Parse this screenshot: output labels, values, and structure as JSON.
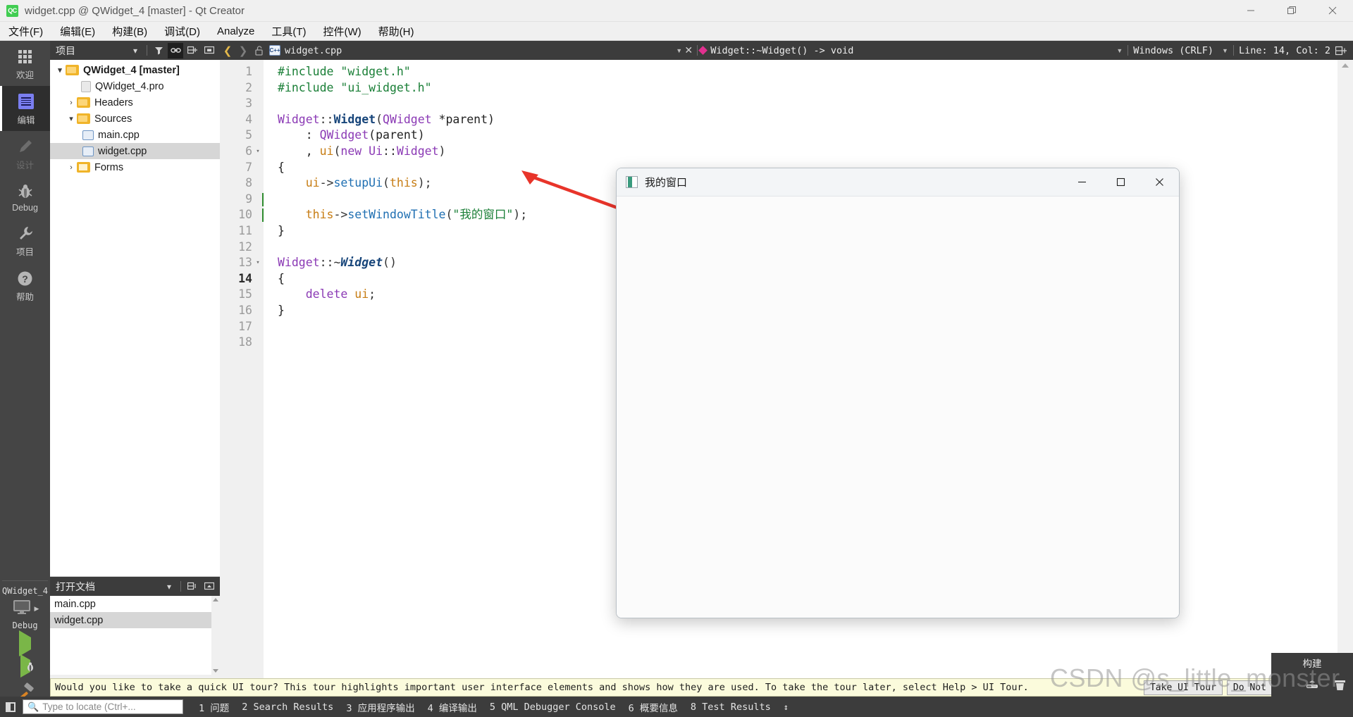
{
  "window": {
    "title": "widget.cpp @ QWidget_4 [master] - Qt Creator",
    "logo_text": "QC",
    "controls": {
      "minimize": "—",
      "maximize": "❐",
      "close": "✕"
    }
  },
  "menubar": {
    "items": [
      {
        "label": "文件(F)",
        "mnemonic": "F"
      },
      {
        "label": "编辑(E)",
        "mnemonic": "E"
      },
      {
        "label": "构建(B)",
        "mnemonic": "B"
      },
      {
        "label": "调试(D)",
        "mnemonic": "D"
      },
      {
        "label": "Analyze",
        "mnemonic": "A"
      },
      {
        "label": "工具(T)",
        "mnemonic": "T"
      },
      {
        "label": "控件(W)",
        "mnemonic": "W"
      },
      {
        "label": "帮助(H)",
        "mnemonic": "H"
      }
    ]
  },
  "modebar": {
    "items": [
      {
        "label": "欢迎",
        "icon": "grid-icon",
        "state": "normal"
      },
      {
        "label": "编辑",
        "icon": "document-lines-icon",
        "state": "active"
      },
      {
        "label": "设计",
        "icon": "pencil-icon",
        "state": "disabled"
      },
      {
        "label": "Debug",
        "icon": "bug-icon",
        "state": "normal"
      },
      {
        "label": "项目",
        "icon": "wrench-icon",
        "state": "normal"
      },
      {
        "label": "帮助",
        "icon": "question-circle-icon",
        "state": "normal"
      }
    ],
    "kit": {
      "project_name": "QWidget_4",
      "build_config": "Debug",
      "target_icon": "desktop-icon",
      "run_label": "run-button",
      "debug_label": "debug-button",
      "build_label": "build-hammer-button"
    }
  },
  "sidepanel": {
    "projects": {
      "header": "项目",
      "tools": [
        "chevron-down-icon",
        "filter-icon",
        "link-icon",
        "split-icon",
        "close-panel-icon"
      ],
      "tree": [
        {
          "label": "QWidget_4 [master]",
          "indent": 0,
          "arrow": "⌄",
          "icon": "folder",
          "bold": true,
          "selected": false
        },
        {
          "label": "QWidget_4.pro",
          "indent": 1,
          "arrow": "",
          "icon": "doc",
          "bold": false,
          "selected": false
        },
        {
          "label": "Headers",
          "indent": 1,
          "arrow": "›",
          "icon": "folder",
          "bold": false,
          "selected": false
        },
        {
          "label": "Sources",
          "indent": 1,
          "arrow": "⌄",
          "icon": "folder",
          "bold": false,
          "selected": false
        },
        {
          "label": "main.cpp",
          "indent": 2,
          "arrow": "",
          "icon": "cpp",
          "bold": false,
          "selected": false
        },
        {
          "label": "widget.cpp",
          "indent": 2,
          "arrow": "",
          "icon": "cpp",
          "bold": false,
          "selected": true
        },
        {
          "label": "Forms",
          "indent": 1,
          "arrow": "›",
          "icon": "form",
          "bold": false,
          "selected": false
        }
      ]
    },
    "opendocs": {
      "header": "打开文档",
      "tools": [
        "chevron-down-icon",
        "split-icon",
        "close-panel-icon"
      ],
      "items": [
        {
          "label": "main.cpp",
          "selected": false
        },
        {
          "label": "widget.cpp",
          "selected": true
        }
      ]
    }
  },
  "editor_toolbar": {
    "file_name": "widget.cpp",
    "symbol": "Widget::~Widget() -> void",
    "line_ending": "Windows (CRLF)",
    "cursor_pos": "Line: 14, Col: 2",
    "back_icon": "back-chevron-icon",
    "forward_icon": "forward-chevron-icon",
    "lock_icon": "unlocked-icon",
    "close_icon": "close-icon",
    "split_icon": "split-editor-icon"
  },
  "code": {
    "current_line": 14,
    "lines": [
      {
        "n": 1,
        "fold": "",
        "tokens": [
          {
            "t": "#include ",
            "c": "k-pre"
          },
          {
            "t": "\"widget.h\"",
            "c": "k-str"
          }
        ]
      },
      {
        "n": 2,
        "fold": "",
        "tokens": [
          {
            "t": "#include ",
            "c": "k-pre"
          },
          {
            "t": "\"ui_widget.h\"",
            "c": "k-str"
          }
        ]
      },
      {
        "n": 3,
        "fold": "",
        "tokens": []
      },
      {
        "n": 4,
        "fold": "",
        "tokens": [
          {
            "t": "Widget",
            "c": "k-kw"
          },
          {
            "t": "::",
            "c": "k-op"
          },
          {
            "t": "Widget",
            "c": "k-bold"
          },
          {
            "t": "(",
            "c": "k-op"
          },
          {
            "t": "QWidget",
            "c": "k-kw"
          },
          {
            "t": " *parent)",
            "c": "k-pln"
          }
        ]
      },
      {
        "n": 5,
        "fold": "",
        "tokens": [
          {
            "t": "    : ",
            "c": "k-pln"
          },
          {
            "t": "QWidget",
            "c": "k-kw"
          },
          {
            "t": "(parent)",
            "c": "k-pln"
          }
        ]
      },
      {
        "n": 6,
        "fold": "▾",
        "tokens": [
          {
            "t": "    , ",
            "c": "k-pln"
          },
          {
            "t": "ui",
            "c": "k-var"
          },
          {
            "t": "(",
            "c": "k-op"
          },
          {
            "t": "new",
            "c": "k-kw"
          },
          {
            "t": " ",
            "c": "k-pln"
          },
          {
            "t": "Ui",
            "c": "k-kw"
          },
          {
            "t": "::",
            "c": "k-op"
          },
          {
            "t": "Widget",
            "c": "k-kw"
          },
          {
            "t": ")",
            "c": "k-op"
          }
        ]
      },
      {
        "n": 7,
        "fold": "",
        "tokens": [
          {
            "t": "{",
            "c": "k-pln"
          }
        ]
      },
      {
        "n": 8,
        "fold": "",
        "tokens": [
          {
            "t": "    ",
            "c": "k-pln"
          },
          {
            "t": "ui",
            "c": "k-var"
          },
          {
            "t": "->",
            "c": "k-op"
          },
          {
            "t": "setupUi",
            "c": "k-fn"
          },
          {
            "t": "(",
            "c": "k-op"
          },
          {
            "t": "this",
            "c": "k-var"
          },
          {
            "t": ");",
            "c": "k-op"
          }
        ]
      },
      {
        "n": 9,
        "fold": "",
        "tokens": []
      },
      {
        "n": 10,
        "fold": "",
        "tokens": [
          {
            "t": "    ",
            "c": "k-pln"
          },
          {
            "t": "this",
            "c": "k-var"
          },
          {
            "t": "->",
            "c": "k-op"
          },
          {
            "t": "setWindowTitle",
            "c": "k-fn"
          },
          {
            "t": "(",
            "c": "k-op"
          },
          {
            "t": "\"我的窗口\"",
            "c": "k-str"
          },
          {
            "t": ");",
            "c": "k-op"
          }
        ]
      },
      {
        "n": 11,
        "fold": "",
        "tokens": [
          {
            "t": "}",
            "c": "k-pln"
          }
        ]
      },
      {
        "n": 12,
        "fold": "",
        "tokens": []
      },
      {
        "n": 13,
        "fold": "▾",
        "tokens": [
          {
            "t": "Widget",
            "c": "k-kw"
          },
          {
            "t": "::~",
            "c": "k-op"
          },
          {
            "t": "Widget",
            "c": "k-ital"
          },
          {
            "t": "()",
            "c": "k-op"
          }
        ]
      },
      {
        "n": 14,
        "fold": "",
        "tokens": [
          {
            "t": "{",
            "c": "k-pln"
          }
        ]
      },
      {
        "n": 15,
        "fold": "",
        "tokens": [
          {
            "t": "    ",
            "c": "k-pln"
          },
          {
            "t": "delete",
            "c": "k-kw"
          },
          {
            "t": " ",
            "c": "k-pln"
          },
          {
            "t": "ui",
            "c": "k-var"
          },
          {
            "t": ";",
            "c": "k-op"
          }
        ]
      },
      {
        "n": 16,
        "fold": "",
        "tokens": [
          {
            "t": "}",
            "c": "k-pln"
          }
        ]
      },
      {
        "n": 17,
        "fold": "",
        "tokens": []
      },
      {
        "n": 18,
        "fold": "",
        "tokens": []
      }
    ]
  },
  "qt_window": {
    "title": "我的窗口",
    "controls": {
      "minimize": "—",
      "maximize": "□",
      "close": "✕"
    },
    "icon": "qt-widget-icon"
  },
  "tour_banner": {
    "text": "Would you like to take a quick UI tour? This tour highlights important user interface elements and shows how they are used. To take the tour later, select Help > UI Tour.",
    "buttons": [
      "Take UI Tour",
      "Do Not Show Again"
    ],
    "close": "✕"
  },
  "statusbar": {
    "toggle_icon": "toggle-sidebar-icon",
    "locator_placeholder": "Type to locate (Ctrl+...",
    "search_icon": "search-icon",
    "panels": [
      "1 问题",
      "2 Search Results",
      "3 应用程序输出",
      "4 编译输出",
      "5 QML Debugger Console",
      "6 概要信息",
      "8 Test Results"
    ],
    "updown_icon": "up-down-arrows-icon"
  },
  "build_panel": {
    "title": "构建",
    "progress_icon": "progress-bar-icon",
    "clear_icon": "trash-icon"
  },
  "watermark": {
    "text": "CSDN @s_little_monster"
  },
  "annotation": {
    "arrow_color": "#e8342a",
    "name": "red-pointer-arrow"
  }
}
